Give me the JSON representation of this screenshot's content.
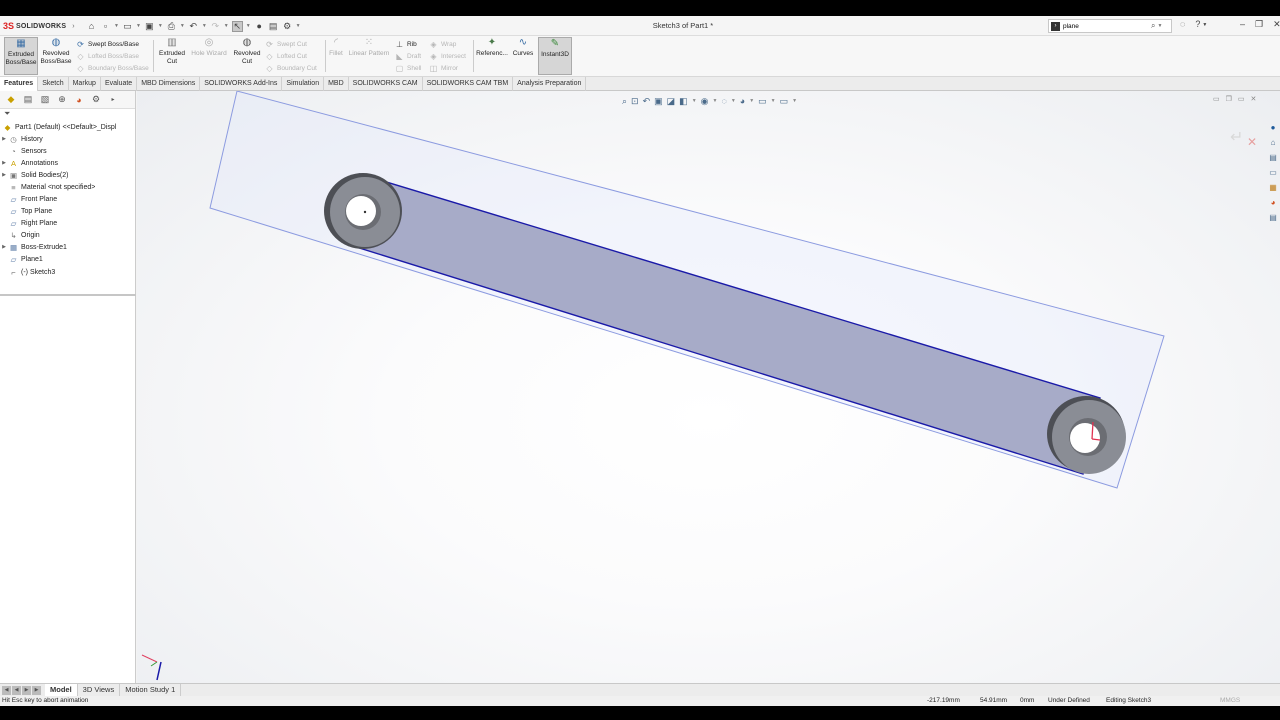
{
  "app": {
    "logo_mark": "3S",
    "logo_text": "SOLIDWORKS",
    "document_title": "Sketch3 of Part1 *"
  },
  "search": {
    "value": "plane",
    "placeholder": ""
  },
  "command_manager": {
    "extruded_boss": "Extruded Boss/Base",
    "revolved_boss": "Revolved Boss/Base",
    "swept_boss": "Swept Boss/Base",
    "lofted_boss": "Lofted Boss/Base",
    "boundary_boss": "Boundary Boss/Base",
    "extruded_cut": "Extruded Cut",
    "hole_wizard": "Hole Wizard",
    "revolved_cut": "Revolved Cut",
    "swept_cut": "Swept Cut",
    "lofted_cut": "Lofted Cut",
    "boundary_cut": "Boundary Cut",
    "fillet": "Fillet",
    "linear_pattern": "Linear Pattern",
    "rib": "Rib",
    "draft": "Draft",
    "shell": "Shell",
    "wrap": "Wrap",
    "intersect": "Intersect",
    "mirror": "Mirror",
    "reference": "Referenc...",
    "curves": "Curves",
    "instant3d": "Instant3D"
  },
  "tabs": [
    "Features",
    "Sketch",
    "Markup",
    "Evaluate",
    "MBD Dimensions",
    "SOLIDWORKS Add-Ins",
    "Simulation",
    "MBD",
    "SOLIDWORKS CAM",
    "SOLIDWORKS CAM TBM",
    "Analysis Preparation"
  ],
  "tree": {
    "root": "Part1 (Default) <<Default>_Displ",
    "items": [
      {
        "label": "History",
        "icon": "history-icon"
      },
      {
        "label": "Sensors",
        "icon": "sensors-icon"
      },
      {
        "label": "Annotations",
        "icon": "annotations-icon"
      },
      {
        "label": "Solid Bodies(2)",
        "icon": "solid-bodies-icon"
      },
      {
        "label": "Material <not specified>",
        "icon": "material-icon"
      },
      {
        "label": "Front Plane",
        "icon": "plane-icon"
      },
      {
        "label": "Top Plane",
        "icon": "plane-icon"
      },
      {
        "label": "Right Plane",
        "icon": "plane-icon"
      },
      {
        "label": "Origin",
        "icon": "origin-icon"
      },
      {
        "label": "Boss-Extrude1",
        "icon": "extrude-icon"
      },
      {
        "label": "Plane1",
        "icon": "plane-icon"
      },
      {
        "label": "(-) Sketch3",
        "icon": "sketch-icon"
      }
    ]
  },
  "bottom_tabs": [
    "Model",
    "3D Views",
    "Motion Study 1"
  ],
  "status": {
    "message": "Hit Esc key to abort animation",
    "x": "-217.19mm",
    "y": "54.91mm",
    "z": "0mm",
    "definition": "Under Defined",
    "mode": "Editing Sketch3",
    "units": "MMGS"
  },
  "colors": {
    "sketch_blue": "#1a1aa8",
    "link_fill": "#9ea3c2",
    "boss_gray": "#4d4f55",
    "plane_outline": "#8c9be0"
  }
}
